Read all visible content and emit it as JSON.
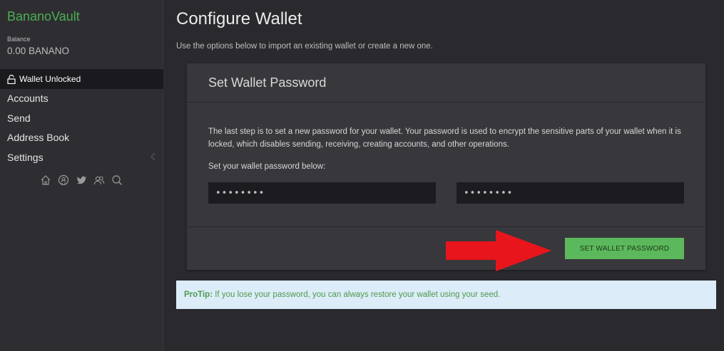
{
  "sidebar": {
    "brand": "BananoVault",
    "balance_label": "Balance",
    "balance_value": "0.00 BANANO",
    "lock_status": "Wallet Unlocked",
    "nav": [
      "Accounts",
      "Send",
      "Address Book",
      "Settings"
    ],
    "social_icons": [
      "home-icon",
      "github-icon",
      "twitter-icon",
      "users-icon",
      "search-icon"
    ]
  },
  "main": {
    "title": "Configure Wallet",
    "subtitle": "Use the options below to import an existing wallet or create a new one.",
    "card": {
      "title": "Set Wallet Password",
      "description": "The last step is to set a new password for your wallet. Your password is used to encrypt the sensitive parts of your wallet when it is locked, which disables sending, receiving, creating accounts, and other operations.",
      "label": "Set your wallet password below:",
      "password_value": "••••••••",
      "confirm_value": "••••••••",
      "button_label": "SET WALLET PASSWORD"
    },
    "protip": {
      "prefix": "ProTip:",
      "text": " If you lose your password, you can always restore your wallet using your seed."
    }
  },
  "colors": {
    "brand": "#4caf50",
    "button": "#5cb85c",
    "arrow": "#e8151c",
    "protip_bg": "#dcecf8"
  }
}
